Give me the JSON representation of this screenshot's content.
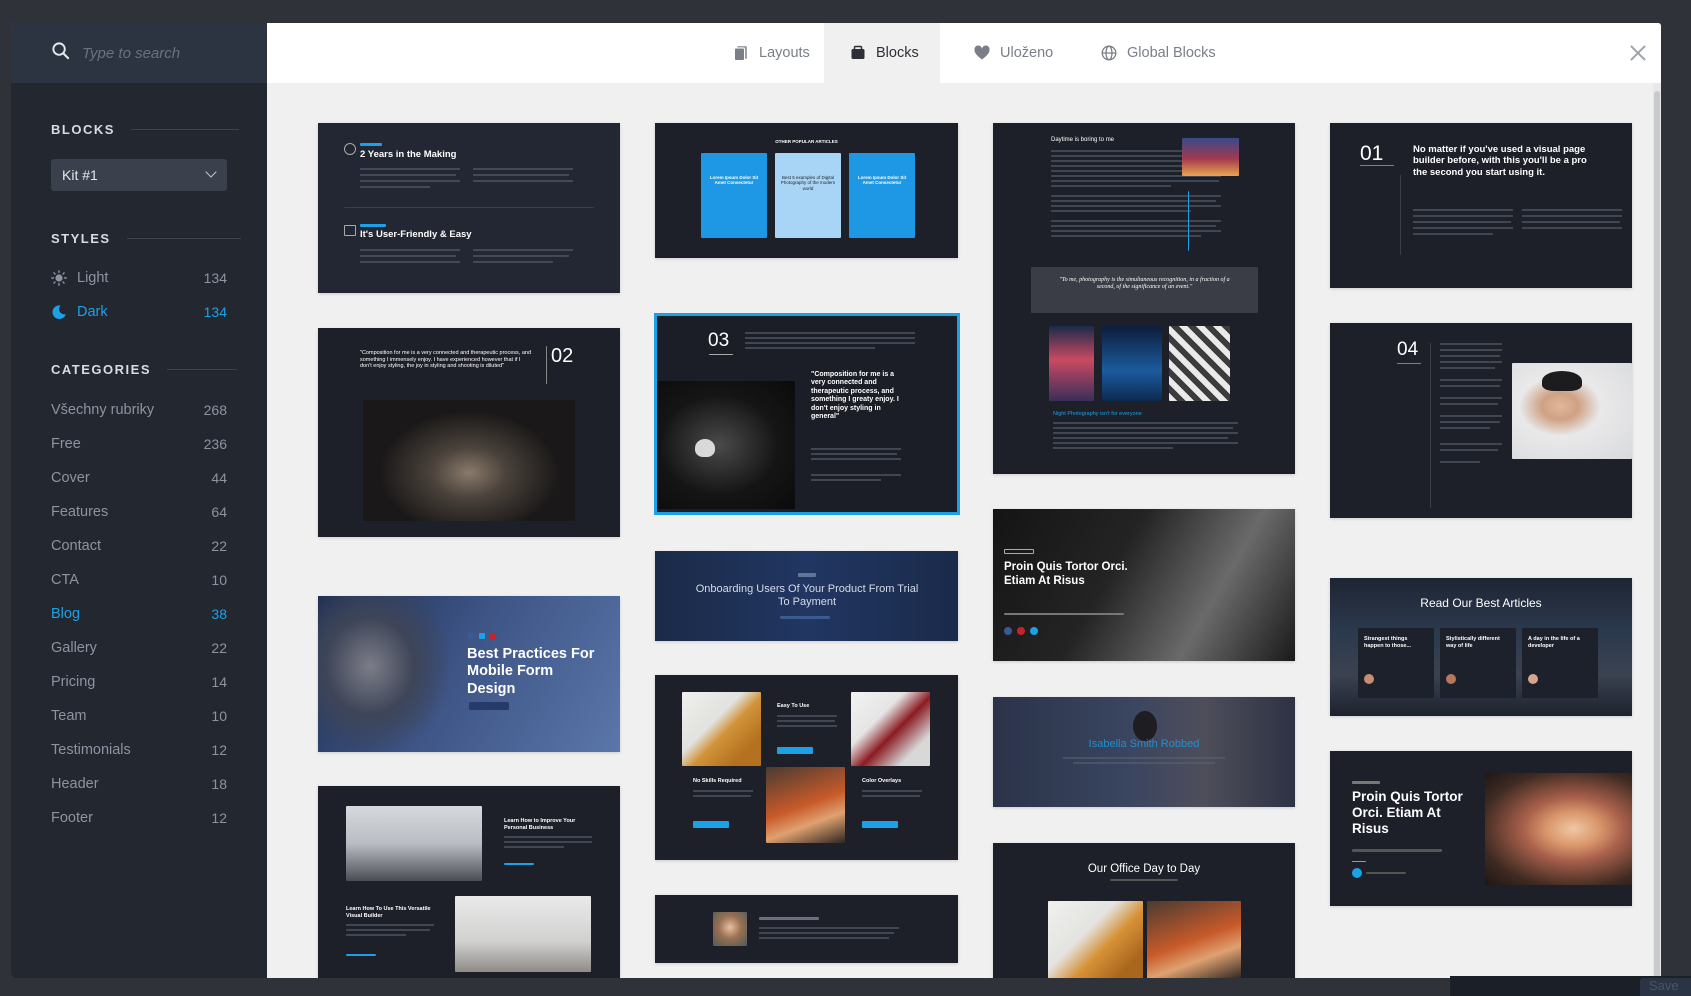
{
  "search": {
    "placeholder": "Type to search"
  },
  "sidebar": {
    "blocks_title": "BLOCKS",
    "kit_selected": "Kit #1",
    "styles_title": "STYLES",
    "styles": [
      {
        "label": "Light",
        "count": "134",
        "icon": "sun-icon"
      },
      {
        "label": "Dark",
        "count": "134",
        "icon": "moon-icon",
        "active": true
      }
    ],
    "categories_title": "CATEGORIES",
    "categories": [
      {
        "label": "Všechny rubriky",
        "count": "268"
      },
      {
        "label": "Free",
        "count": "236"
      },
      {
        "label": "Cover",
        "count": "44"
      },
      {
        "label": "Features",
        "count": "64"
      },
      {
        "label": "Contact",
        "count": "22"
      },
      {
        "label": "CTA",
        "count": "10"
      },
      {
        "label": "Blog",
        "count": "38",
        "active": true
      },
      {
        "label": "Gallery",
        "count": "22"
      },
      {
        "label": "Pricing",
        "count": "14"
      },
      {
        "label": "Team",
        "count": "10"
      },
      {
        "label": "Testimonials",
        "count": "12"
      },
      {
        "label": "Header",
        "count": "18"
      },
      {
        "label": "Footer",
        "count": "12"
      }
    ]
  },
  "tabs": [
    {
      "label": "Layouts",
      "icon": "layouts-icon"
    },
    {
      "label": "Blocks",
      "icon": "blocks-icon",
      "active": true
    },
    {
      "label": "Uloženo",
      "icon": "heart-icon"
    },
    {
      "label": "Global Blocks",
      "icon": "globe-icon"
    }
  ],
  "cards": {
    "c1": {
      "t1": "2 Years in the Making",
      "t2": "It's User-Friendly & Easy"
    },
    "c2": {
      "quote": "\"Composition for me is a very connected and therapeutic process, and something I immensely enjoy. I have experienced however that if I don't enjoy styling, the joy in styling and shooting is diluted\"",
      "num": "02"
    },
    "c3": {
      "title": "Best Practices For Mobile Form Design"
    },
    "c4": {
      "t1": "Learn How to Improve Your Personal Business",
      "t2": "Learn How To Use This Versatile Visual Builder"
    },
    "c5": {
      "heading": "OTHER POPULAR ARTICLES",
      "a": "Lorem Ipsum Dolor Sit Amet Consectetur",
      "b": "Best 5 examples of Digital Photography of the modern world",
      "c": "Lorem Ipsum Dolor Sit Amet Consectetur"
    },
    "c6": {
      "num": "03",
      "quote": "\"Composition for me is a very connected and therapeutic process, and something I greaty enjoy. I don't enjoy styling in general\""
    },
    "c7": {
      "title": "Onboarding Users Of Your Product From Trial To Payment"
    },
    "c8": {
      "t1": "Easy To Use",
      "t2": "No Skills Required",
      "t3": "Color Overlays"
    },
    "c10": {
      "heading": "Daytime is boring to me",
      "quote": "\"To me, photography is the simultaneous recognition, in a fraction of a second, of the significance of an event.\"",
      "caption": "Night Photography isn't for everyone"
    },
    "c11": {
      "title": "Proin Quis Tortor Orci. Etiam At Risus"
    },
    "c12": {
      "name": "Isabella Smith Robbed"
    },
    "c13": {
      "title": "Our Office Day to Day"
    },
    "c14": {
      "num": "01",
      "title": "No matter if you've used a visual page builder before, with this you'll be a pro the second you start using it."
    },
    "c15": {
      "num": "04"
    },
    "c16": {
      "title": "Read Our Best Articles",
      "a": "Strangest things happen to those...",
      "b": "Stylistically different way of life",
      "c": "A day in the life of a developer"
    },
    "c17": {
      "title": "Proin Quis Tortor Orci. Etiam At Risus"
    }
  },
  "footer": {
    "save_label": "Save"
  }
}
